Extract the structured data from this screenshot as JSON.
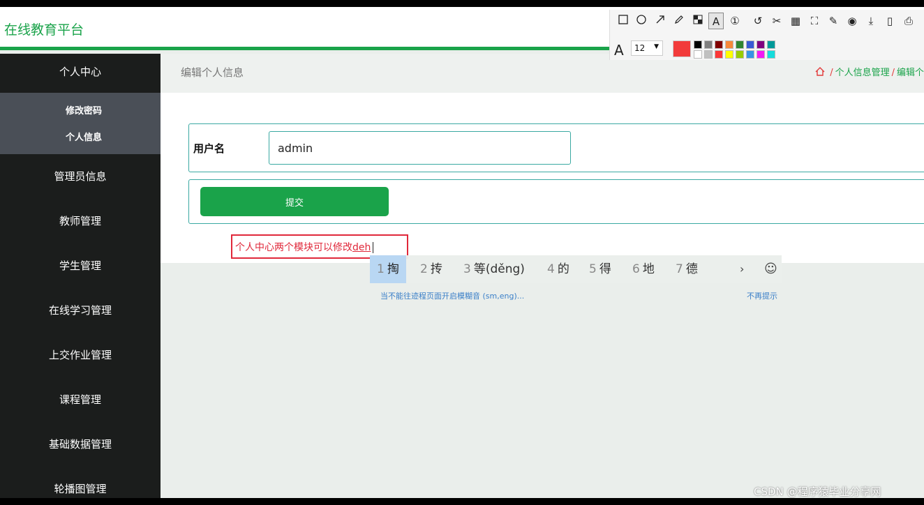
{
  "header": {
    "brand": "在线教育平台"
  },
  "sidebar": {
    "head": "个人中心",
    "sub_items": [
      {
        "label": "修改密码"
      },
      {
        "label": "个人信息"
      }
    ],
    "items": [
      {
        "label": "管理员信息"
      },
      {
        "label": "教师管理"
      },
      {
        "label": "学生管理"
      },
      {
        "label": "在线学习管理"
      },
      {
        "label": "上交作业管理"
      },
      {
        "label": "课程管理"
      },
      {
        "label": "基础数据管理"
      },
      {
        "label": "轮播图管理"
      }
    ]
  },
  "main": {
    "title": "编辑个人信息",
    "breadcrumb": {
      "home_icon": "home-icon",
      "level1": "个人信息管理",
      "level2": "编辑个"
    },
    "form": {
      "username_label": "用户名",
      "username_value": "admin",
      "submit_label": "提交"
    }
  },
  "annotation": {
    "text": "个人中心两个模块可以修改",
    "composition": "deh"
  },
  "ime": {
    "candidates": [
      {
        "num": "1",
        "text": "掏"
      },
      {
        "num": "2",
        "text": "抟"
      },
      {
        "num": "3",
        "text": "等(děng)"
      },
      {
        "num": "4",
        "text": "的"
      },
      {
        "num": "5",
        "text": "得"
      },
      {
        "num": "6",
        "text": "地"
      },
      {
        "num": "7",
        "text": "德"
      }
    ],
    "next_arrow": "›",
    "emoji": "☺",
    "hint_left": "当不能往迹程页面开启模糊音 (sm,eng)...",
    "hint_right": "不再提示"
  },
  "toolbar": {
    "font_size": "12",
    "current_color": "#f23b3b",
    "icons": [
      "rectangle-icon",
      "ellipse-icon",
      "arrow-icon",
      "pencil-icon",
      "mosaic-icon",
      "text-icon",
      "number-icon",
      "undo-icon",
      "cut-icon",
      "ocr-icon",
      "scan-icon",
      "pin-icon",
      "record-icon",
      "download-icon",
      "save-icon",
      "bookmark-icon"
    ],
    "palette": [
      "#000000",
      "#808080",
      "#800000",
      "#f7883a",
      "#308430",
      "#385ad3",
      "#800080",
      "#009999",
      "#ffffff",
      "#c0c0c0",
      "#fb3838",
      "#ffff00",
      "#99cc00",
      "#3894e4",
      "#f31bf3",
      "#16dcdc"
    ]
  },
  "watermark": {
    "csdn": "CSDN @程序猿毕业分享网"
  }
}
